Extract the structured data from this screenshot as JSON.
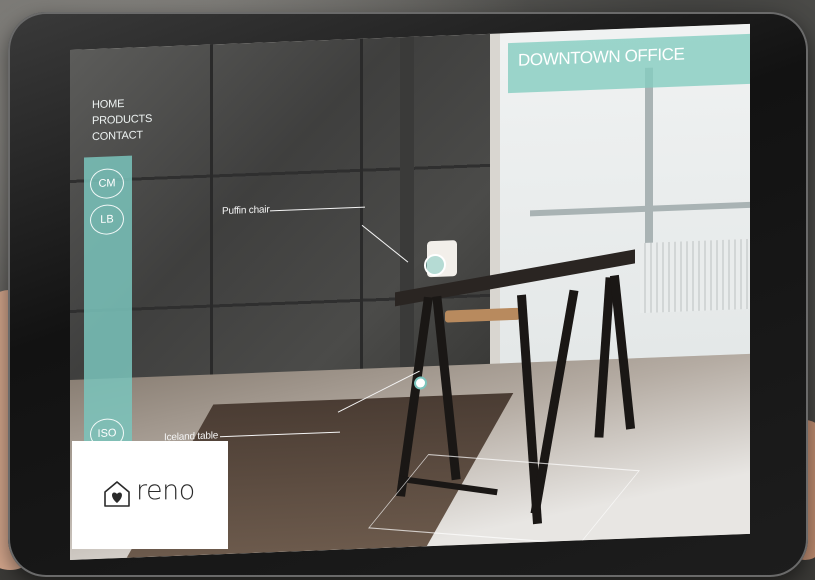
{
  "nav": {
    "items": [
      "HOME",
      "PRODUCTS",
      "CONTACT"
    ]
  },
  "unit_buttons": {
    "cm": "CM",
    "lb": "LB",
    "iso": "ISO"
  },
  "banner": {
    "title": "DOWNTOWN OFFICE"
  },
  "annotations": {
    "chair": "Puffin chair",
    "table": "Iceland table"
  },
  "logo": {
    "text": "reno",
    "icon": "house-heart-icon"
  },
  "colors": {
    "accent": "#7ac4bc",
    "logo_bg": "#ffffff"
  }
}
